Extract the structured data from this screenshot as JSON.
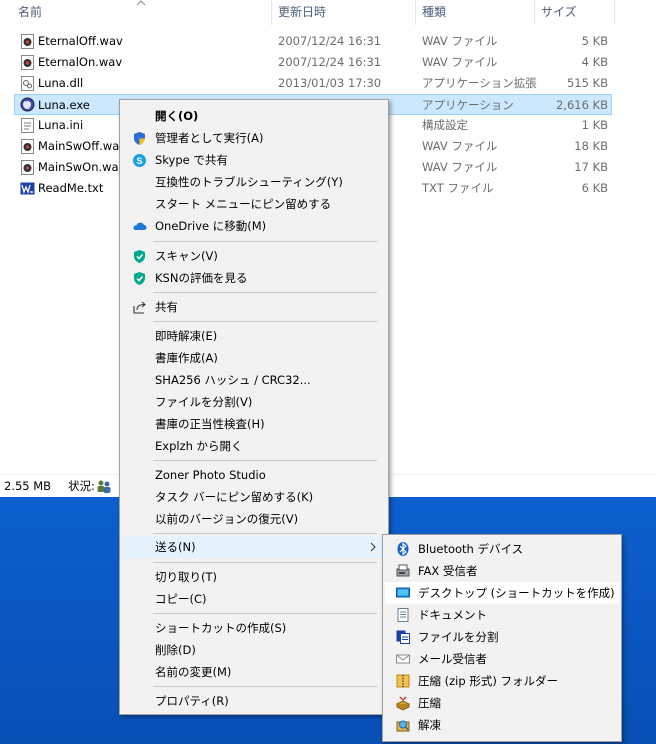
{
  "columns": {
    "name": "名前",
    "date": "更新日時",
    "type": "種類",
    "size": "サイズ"
  },
  "files": [
    {
      "name": "EternalOff.wav",
      "date": "2007/12/24 16:31",
      "type": "WAV ファイル",
      "size": "5 KB",
      "icon": "wav-icon"
    },
    {
      "name": "EternalOn.wav",
      "date": "2007/12/24 16:31",
      "type": "WAV ファイル",
      "size": "4 KB",
      "icon": "wav-icon"
    },
    {
      "name": "Luna.dll",
      "date": "2013/01/03 17:30",
      "type": "アプリケーション拡張",
      "size": "515 KB",
      "icon": "dll-icon"
    },
    {
      "name": "Luna.exe",
      "date": "",
      "type": "アプリケーション",
      "size": "2,616 KB",
      "icon": "exe-icon",
      "selected": true
    },
    {
      "name": "Luna.ini",
      "date": "",
      "type": "構成設定",
      "size": "1 KB",
      "icon": "ini-icon"
    },
    {
      "name": "MainSwOff.wav",
      "date": "",
      "type": "WAV ファイル",
      "size": "18 KB",
      "icon": "wav-icon"
    },
    {
      "name": "MainSwOn.wav",
      "date": "",
      "type": "WAV ファイル",
      "size": "17 KB",
      "icon": "wav-icon"
    },
    {
      "name": "ReadMe.txt",
      "date": "",
      "type": "TXT ファイル",
      "size": "6 KB",
      "icon": "txt-icon"
    }
  ],
  "status": {
    "size": "2.55 MB",
    "state_label": "状況:"
  },
  "context_menu": {
    "open": "開く(O)",
    "run_as_admin": "管理者として実行(A)",
    "skype_share": "Skype で共有",
    "troubleshoot": "互換性のトラブルシューティング(Y)",
    "pin_start": "スタート メニューにピン留めする",
    "onedrive_move": "OneDrive に移動(M)",
    "scan": "スキャン(V)",
    "ksn": "KSNの評価を見る",
    "share": "共有",
    "extract": "即時解凍(E)",
    "create_archive": "書庫作成(A)",
    "sha256": "SHA256 ハッシュ / CRC32...",
    "split": "ファイルを分割(V)",
    "verify": "書庫の正当性検査(H)",
    "explzh_open": "Explzh から開く",
    "zoner": "Zoner Photo Studio",
    "pin_taskbar": "タスク バーにピン留めする(K)",
    "restore_versions": "以前のバージョンの復元(V)",
    "send_to": "送る(N)",
    "cut": "切り取り(T)",
    "copy": "コピー(C)",
    "create_shortcut": "ショートカットの作成(S)",
    "delete": "削除(D)",
    "rename": "名前の変更(M)",
    "properties": "プロパティ(R)"
  },
  "send_to_menu": {
    "bluetooth": "Bluetooth デバイス",
    "fax": "FAX 受信者",
    "desktop": "デスクトップ (ショートカットを作成)",
    "documents": "ドキュメント",
    "split_file": "ファイルを分割",
    "mail": "メール受信者",
    "zip": "圧縮 (zip 形式) フォルダー",
    "compress": "圧縮",
    "decompress": "解凍"
  },
  "colors": {
    "accent": "#0078d7",
    "selection": "#cce8ff",
    "taskbar": "#0b5ac6",
    "menu_bg": "#f2f2f2",
    "menu_hover": "#e5f3ff"
  }
}
